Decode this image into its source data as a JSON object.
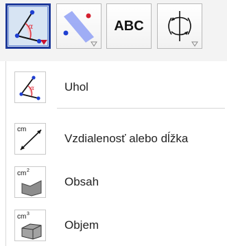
{
  "toolbar": {
    "buttons": [
      {
        "id": "angle-tool",
        "active": true,
        "icon": "angle-icon"
      },
      {
        "id": "line-tools",
        "active": false,
        "icon": "line-points-icon"
      },
      {
        "id": "text-tool",
        "active": false,
        "icon": "text-icon",
        "label": "ABC"
      },
      {
        "id": "transform-tools",
        "active": false,
        "icon": "rotate-axes-icon"
      }
    ]
  },
  "menu": {
    "items": [
      {
        "label": "Uhol",
        "icon": "angle-icon"
      },
      {
        "label": "Vzdialenosť alebo dĺžka",
        "icon": "distance-icon",
        "icon_text": "cm"
      },
      {
        "label": "Obsah",
        "icon": "area-icon",
        "icon_text": "cm",
        "icon_sup": "2"
      },
      {
        "label": "Objem",
        "icon": "volume-icon",
        "icon_text": "cm",
        "icon_sup": "3"
      }
    ]
  },
  "colors": {
    "active_border": "#1f3a9a",
    "active_fill": "#d7e4f3",
    "angle_arc": "#e0323f",
    "point_blue": "#1f3fd1",
    "line_blue": "#7f8ff2",
    "dropdown_red": "#c8102e"
  }
}
